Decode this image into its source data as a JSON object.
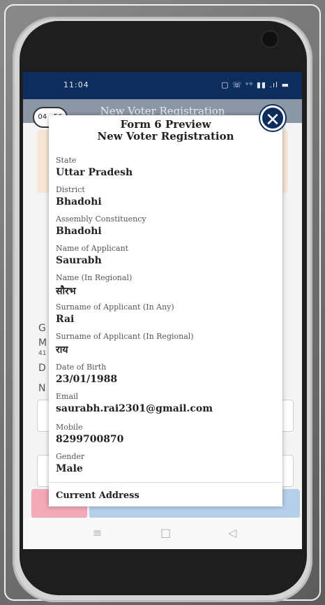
{
  "status_bar": {
    "time": "11:04",
    "icons": "⚲ ▦ ▮ ◆ ⌁ ▮▮▮ ▮▮",
    "right_icons": "▢ ☏ ᵛᵒ ▮▮ .ıl ▬"
  },
  "app": {
    "title": "New Voter Registration",
    "bg_letters": [
      "G",
      "M",
      "D",
      "N"
    ],
    "bg_sub": "41"
  },
  "timer": "04 : 56",
  "close_icon": "✕",
  "modal": {
    "title_line1": "Form 6 Preview",
    "title_line2": "New Voter Registration",
    "fields": [
      {
        "label": "State",
        "value": "Uttar Pradesh"
      },
      {
        "label": "District",
        "value": "Bhadohi"
      },
      {
        "label": "Assembly Constituency",
        "value": "Bhadohi"
      },
      {
        "label": "Name of Applicant",
        "value": "Saurabh"
      },
      {
        "label": "Name (In Regional)",
        "value": "सौरभ"
      },
      {
        "label": "Surname of Applicant (In Any)",
        "value": "Rai"
      },
      {
        "label": "Surname of Applicant (In Regional)",
        "value": "राय"
      },
      {
        "label": "Date of Birth",
        "value": "23/01/1988"
      },
      {
        "label": "Email",
        "value": "saurabh.rai2301@gmail.com"
      },
      {
        "label": "Mobile",
        "value": "8299700870"
      },
      {
        "label": "Gender",
        "value": "Male"
      }
    ],
    "section": "Current Address"
  },
  "nav": {
    "menu": "≡",
    "home": "□",
    "back": "◁"
  }
}
